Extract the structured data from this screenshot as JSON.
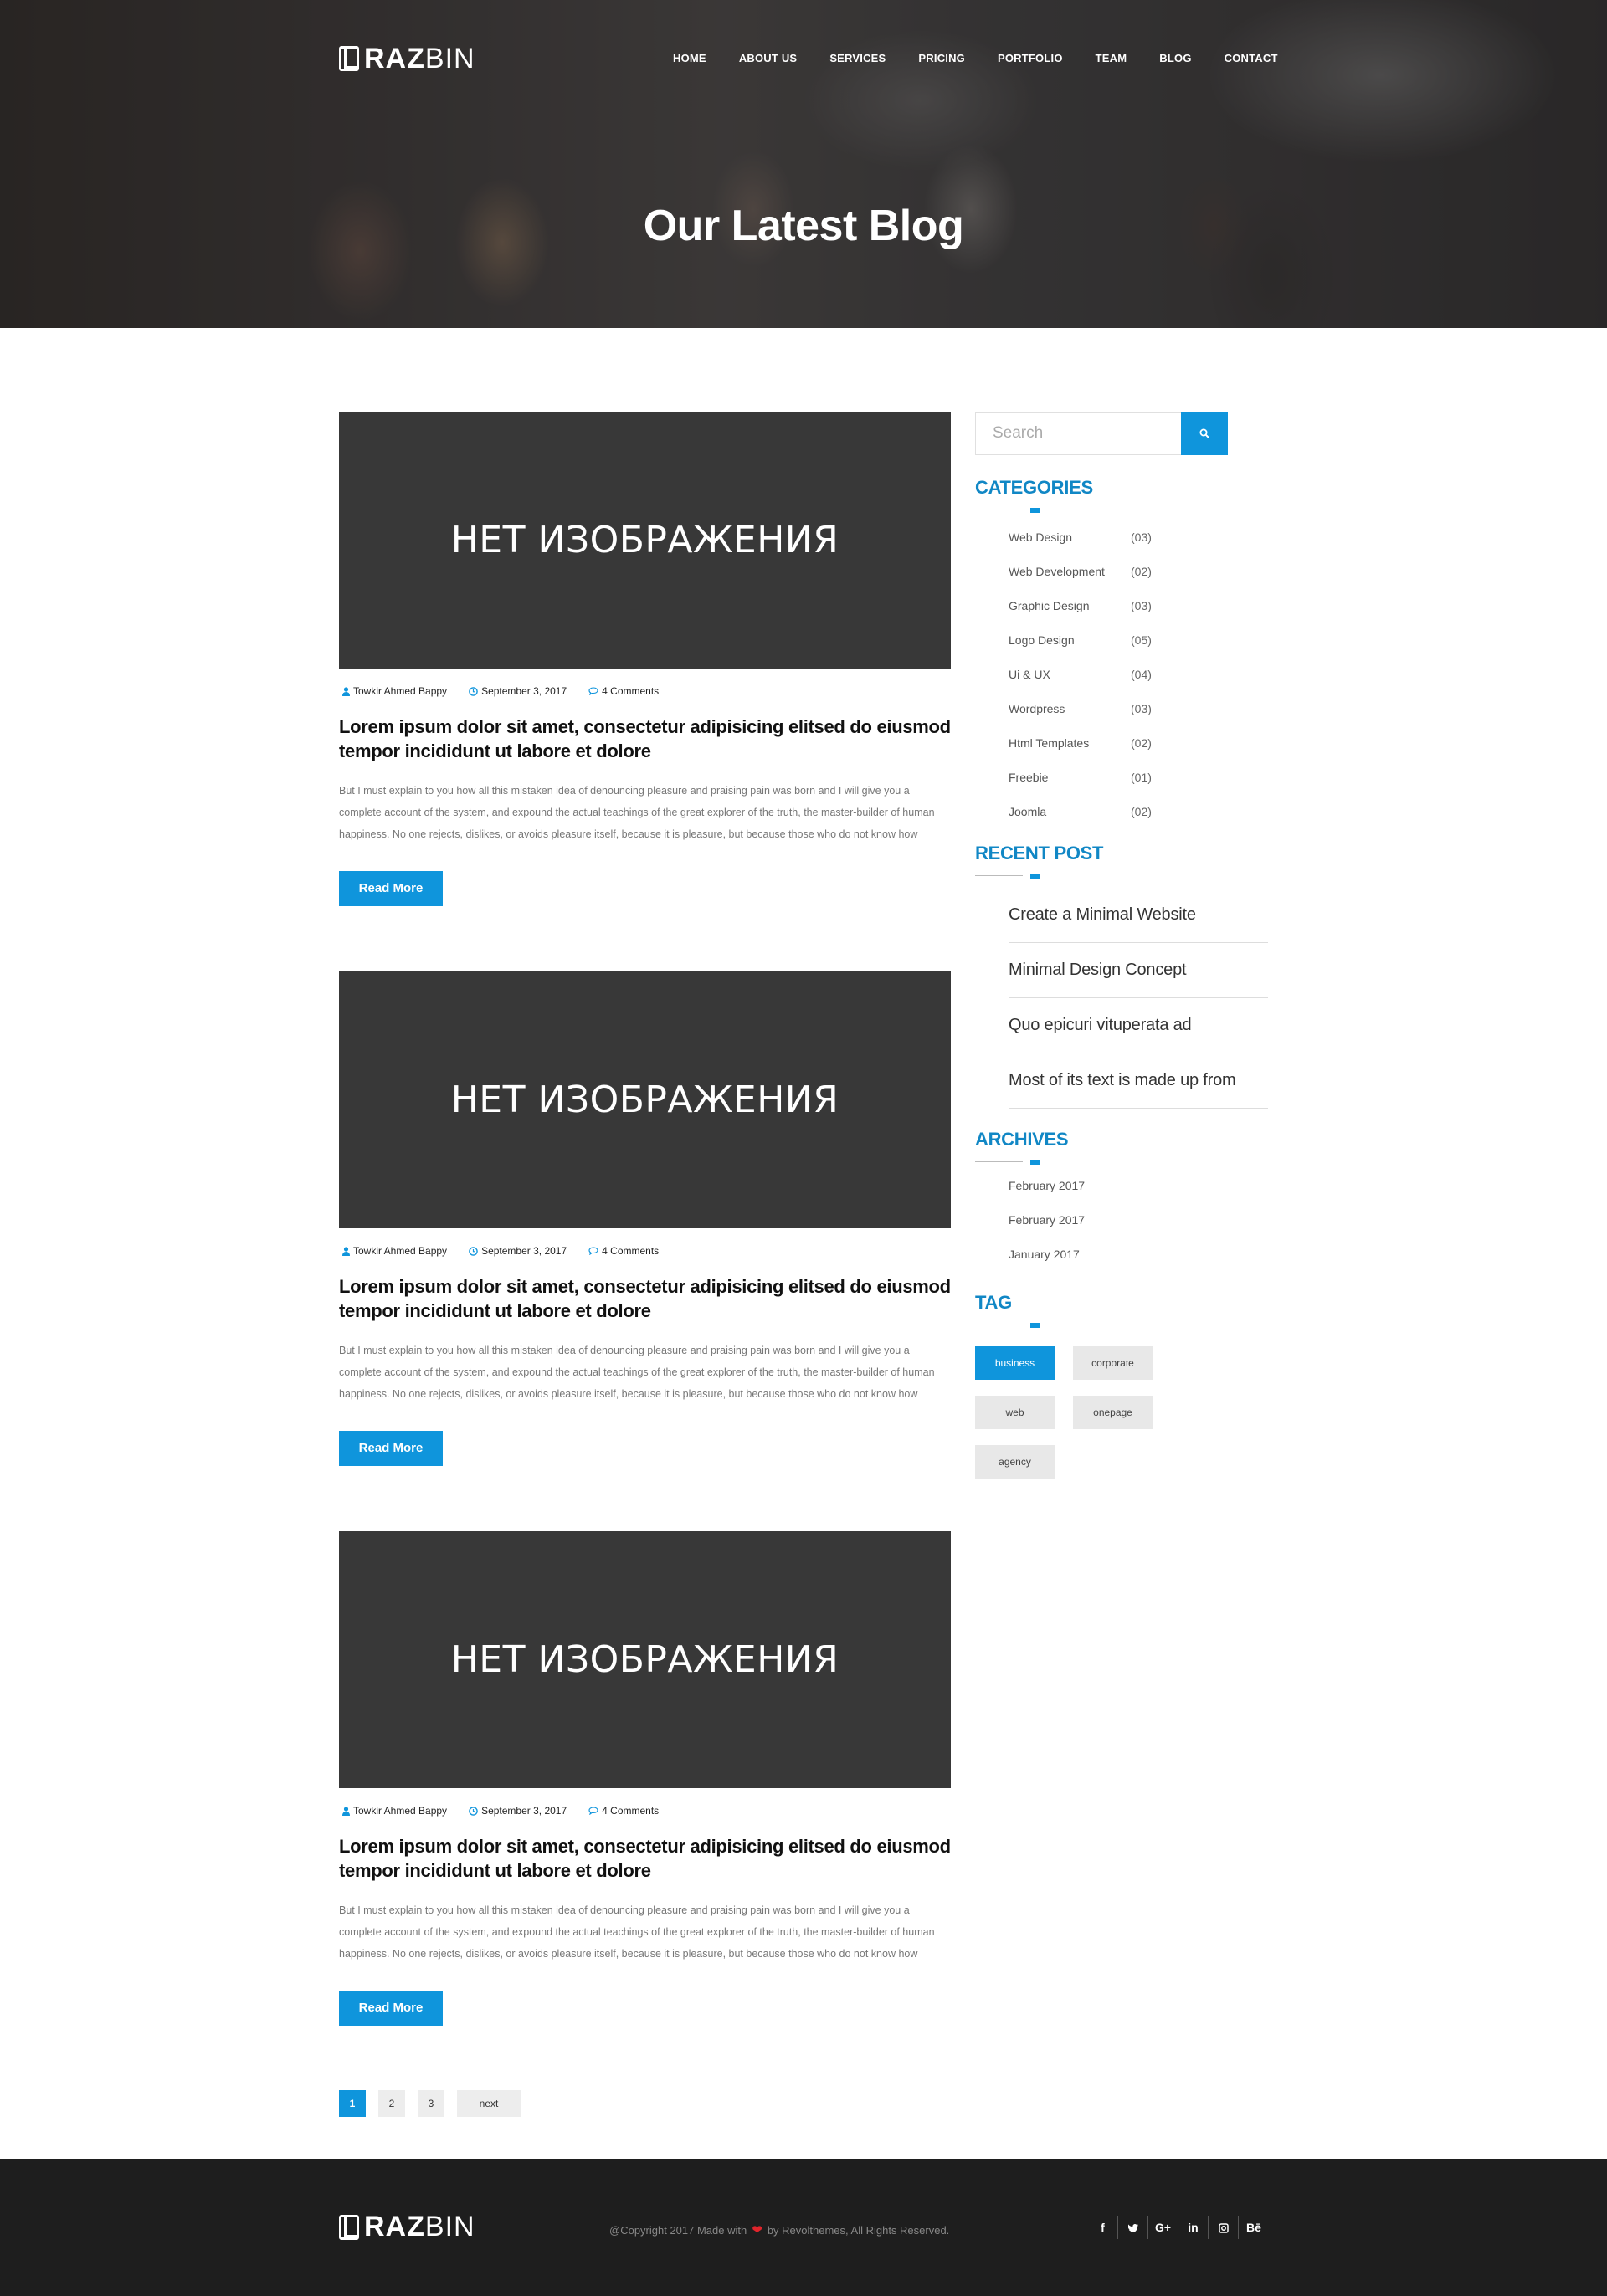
{
  "brand": {
    "bold": "RAZ",
    "light": "BIN"
  },
  "nav": [
    "HOME",
    "ABOUT US",
    "SERVICES",
    "PRICING",
    "PORTFOLIO",
    "TEAM",
    "BLOG",
    "CONTACT"
  ],
  "hero": {
    "title": "Our Latest Blog"
  },
  "posts": [
    {
      "image_text": "НЕТ ИЗОБРАЖЕНИЯ",
      "author": "Towkir Ahmed Bappy",
      "date": "September 3, 2017",
      "comments": "4 Comments",
      "title": "Lorem ipsum dolor sit amet, consectetur adipisicing elitsed do eiusmod tempor incididunt ut labore et dolore",
      "excerpt": "But I must explain to you how all this mistaken idea of denouncing pleasure and praising pain was born and I will give you a complete account of the system, and expound the actual teachings of the great explorer of the truth, the master-builder of human happiness. No one rejects, dislikes, or avoids pleasure itself, because it is pleasure, but because those who do not know how",
      "button": "Read More"
    },
    {
      "image_text": "НЕТ ИЗОБРАЖЕНИЯ",
      "author": "Towkir Ahmed Bappy",
      "date": "September 3, 2017",
      "comments": "4 Comments",
      "title": "Lorem ipsum dolor sit amet, consectetur adipisicing elitsed do eiusmod tempor incididunt ut labore et dolore",
      "excerpt": "But I must explain to you how all this mistaken idea of denouncing pleasure and praising pain was born and I will give you a complete account of the system, and expound the actual teachings of the great explorer of the truth, the master-builder of human happiness. No one rejects, dislikes, or avoids pleasure itself, because it is pleasure, but because those who do not know how",
      "button": "Read More"
    },
    {
      "image_text": "НЕТ ИЗОБРАЖЕНИЯ",
      "author": "Towkir Ahmed Bappy",
      "date": "September 3, 2017",
      "comments": "4 Comments",
      "title": "Lorem ipsum dolor sit amet, consectetur adipisicing elitsed do eiusmod tempor incididunt ut labore et dolore",
      "excerpt": "But I must explain to you how all this mistaken idea of denouncing pleasure and praising pain was born and I will give you a complete account of the system, and expound the actual teachings of the great explorer of the truth, the master-builder of human happiness. No one rejects, dislikes, or avoids pleasure itself, because it is pleasure, but because those who do not know how",
      "button": "Read More"
    }
  ],
  "pagination": {
    "pages": [
      "1",
      "2",
      "3"
    ],
    "next": "next"
  },
  "sidebar": {
    "search_placeholder": "Search",
    "categories_title": "CATEGORIES",
    "categories": [
      {
        "name": "Web Design",
        "count": "(03)"
      },
      {
        "name": "Web Development",
        "count": "(02)"
      },
      {
        "name": "Graphic Design",
        "count": "(03)"
      },
      {
        "name": "Logo Design",
        "count": "(05)"
      },
      {
        "name": "Ui & UX",
        "count": "(04)"
      },
      {
        "name": "Wordpress",
        "count": "(03)"
      },
      {
        "name": "Html Templates",
        "count": "(02)"
      },
      {
        "name": "Freebie",
        "count": "(01)"
      },
      {
        "name": "Joomla",
        "count": "(02)"
      }
    ],
    "recent_title": "RECENT POST",
    "recent": [
      "Create a Minimal Website",
      "Minimal Design Concept",
      "Quo epicuri vituperata ad",
      "Most of its text is made up from"
    ],
    "archives_title": "ARCHIVES",
    "archives": [
      "February 2017",
      "February 2017",
      "January 2017"
    ],
    "tag_title": "TAG",
    "tags": [
      "business",
      "corporate",
      "web",
      "onepage",
      "agency"
    ]
  },
  "footer": {
    "copyright_before": "@Copyright 2017 Made with",
    "copyright_after": "by Revolthemes, All Rights Reserved.",
    "social": [
      "f",
      "t",
      "G+",
      "in",
      "ig",
      "Bē"
    ]
  },
  "colors": {
    "accent": "#0f95dc",
    "dark": "#383838",
    "footer": "#1e1e1e"
  }
}
